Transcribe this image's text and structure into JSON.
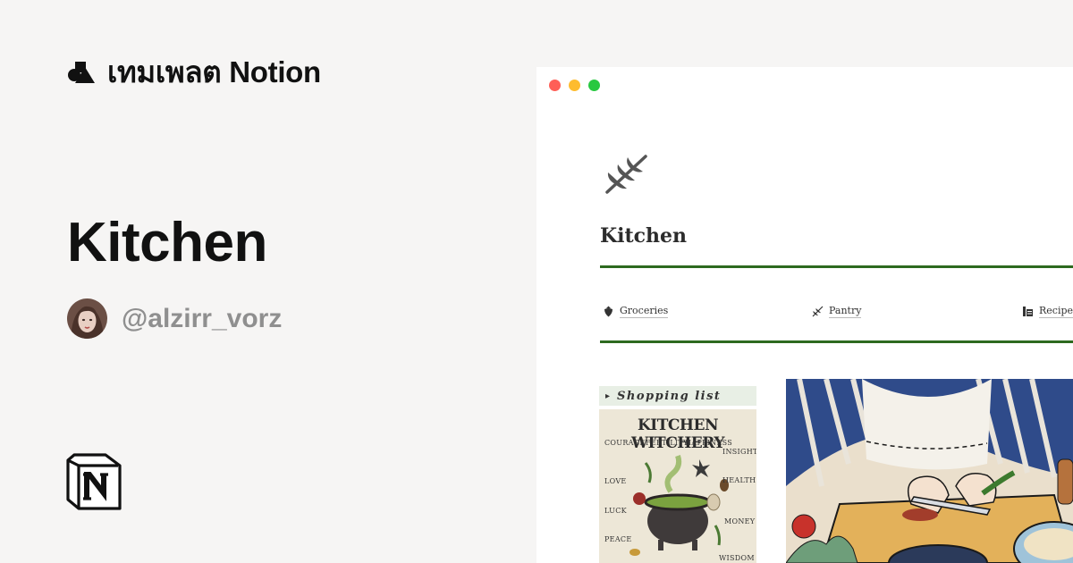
{
  "brand": {
    "text": "เทมเพลต Notion",
    "logo_icon": "shapes-logo-icon"
  },
  "template": {
    "title": "Kitchen",
    "author": "@alzirr_vorz"
  },
  "colors": {
    "background": "#f6f5f4",
    "accent_green": "#2d6a1f",
    "username_gray": "#8f8f8f"
  },
  "preview": {
    "page_icon": "rosemary-sprig-icon",
    "title": "Kitchen",
    "links": [
      {
        "label": "Groceries",
        "icon": "strawberry-icon"
      },
      {
        "label": "Pantry",
        "icon": "rosemary-sprig-icon"
      },
      {
        "label": "Recipes",
        "icon": "cookbook-icon"
      }
    ],
    "toggle_label": "Shopping list",
    "poster": {
      "title": "KITCHEN WITCHERY",
      "labels": [
        "COURAGE",
        "FERTILITY",
        "HAPPINESS",
        "INSIGHT",
        "LOVE",
        "HEALTH",
        "LUCK",
        "MONEY",
        "PEACE",
        "WISDOM"
      ]
    }
  }
}
